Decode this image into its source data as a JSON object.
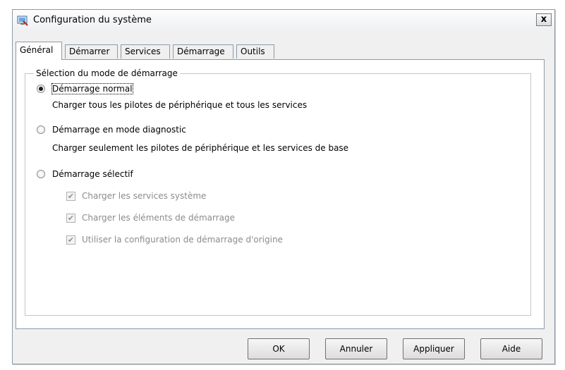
{
  "window": {
    "title": "Configuration du système",
    "close_label": "x"
  },
  "tabs": [
    {
      "label": "Général",
      "active": true
    },
    {
      "label": "Démarrer",
      "active": false
    },
    {
      "label": "Services",
      "active": false
    },
    {
      "label": "Démarrage",
      "active": false
    },
    {
      "label": "Outils",
      "active": false
    }
  ],
  "startup_group": {
    "legend": "Sélection du mode de démarrage",
    "options": [
      {
        "label": "Démarrage normal",
        "selected": true,
        "description": "Charger tous les pilotes de périphérique et tous les services"
      },
      {
        "label": "Démarrage en mode diagnostic",
        "selected": false,
        "description": "Charger seulement les pilotes de périphérique et les services de base"
      },
      {
        "label": "Démarrage sélectif",
        "selected": false,
        "description": ""
      }
    ],
    "selective_checks": [
      {
        "label": "Charger les services système",
        "checked": true,
        "enabled": false
      },
      {
        "label": "Charger les éléments de démarrage",
        "checked": true,
        "enabled": false
      },
      {
        "label": "Utiliser la configuration de démarrage d'origine",
        "checked": true,
        "enabled": false
      }
    ]
  },
  "buttons": {
    "ok": "OK",
    "cancel": "Annuler",
    "apply": "Appliquer",
    "help": "Aide"
  },
  "icons": {
    "app": "system-config-icon",
    "close": "close-icon",
    "check": "checkmark-icon"
  }
}
